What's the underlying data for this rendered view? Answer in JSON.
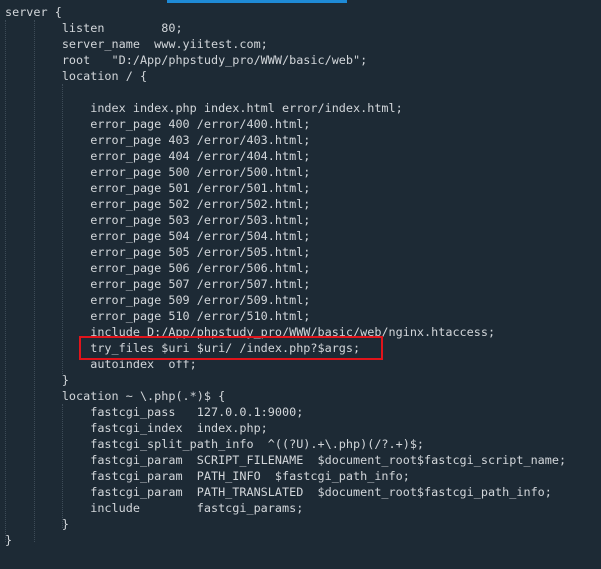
{
  "editor": {
    "highlight_color": "#e0141b",
    "accent": "#1e8ad6",
    "background": "#1d2a35",
    "highlighted_line": "try_files $uri $uri/ /index.php?$args;",
    "lines": [
      "server {",
      "        listen        80;",
      "        server_name  www.yiitest.com;",
      "        root   \"D:/App/phpstudy_pro/WWW/basic/web\";",
      "        location / {",
      "",
      "            index index.php index.html error/index.html;",
      "            error_page 400 /error/400.html;",
      "            error_page 403 /error/403.html;",
      "            error_page 404 /error/404.html;",
      "            error_page 500 /error/500.html;",
      "            error_page 501 /error/501.html;",
      "            error_page 502 /error/502.html;",
      "            error_page 503 /error/503.html;",
      "            error_page 504 /error/504.html;",
      "            error_page 505 /error/505.html;",
      "            error_page 506 /error/506.html;",
      "            error_page 507 /error/507.html;",
      "            error_page 509 /error/509.html;",
      "            error_page 510 /error/510.html;",
      "            include D:/App/phpstudy_pro/WWW/basic/web/nginx.htaccess;",
      "            try_files $uri $uri/ /index.php?$args;",
      "            autoindex  off;",
      "        }",
      "        location ~ \\.php(.*)$ {",
      "            fastcgi_pass   127.0.0.1:9000;",
      "            fastcgi_index  index.php;",
      "            fastcgi_split_path_info  ^((?U).+\\.php)(/?.+)$;",
      "            fastcgi_param  SCRIPT_FILENAME  $document_root$fastcgi_script_name;",
      "            fastcgi_param  PATH_INFO  $fastcgi_path_info;",
      "            fastcgi_param  PATH_TRANSLATED  $document_root$fastcgi_path_info;",
      "            include        fastcgi_params;",
      "        }",
      "}"
    ]
  }
}
